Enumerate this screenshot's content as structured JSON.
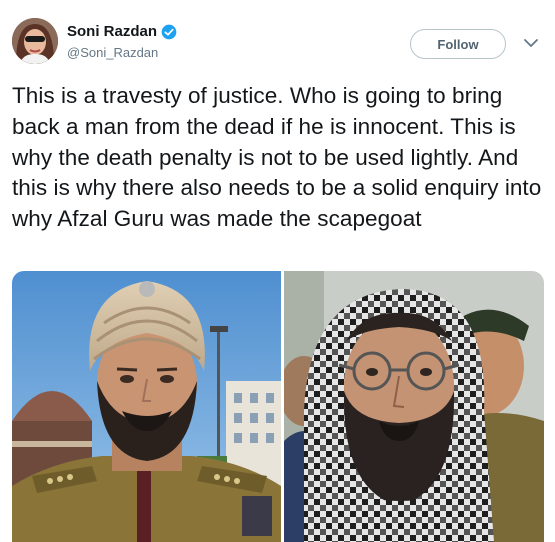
{
  "author": {
    "name": "Soni Razdan",
    "handle": "@Soni_Razdan"
  },
  "follow_label": "Follow",
  "tweet": {
    "text": "This is a travesty of justice. Who is going to bring back a man from the dead if he is innocent. This is why the death penalty is not to be used lightly. And this is why there also needs to be a solid enquiry into why Afzal Guru was made the scapegoat"
  },
  "icons": {
    "verified": "verified-badge-icon",
    "caret": "chevron-down-icon"
  },
  "colors": {
    "verified_blue": "#1da1f2",
    "text": "#14171a",
    "handle": "#657786"
  }
}
